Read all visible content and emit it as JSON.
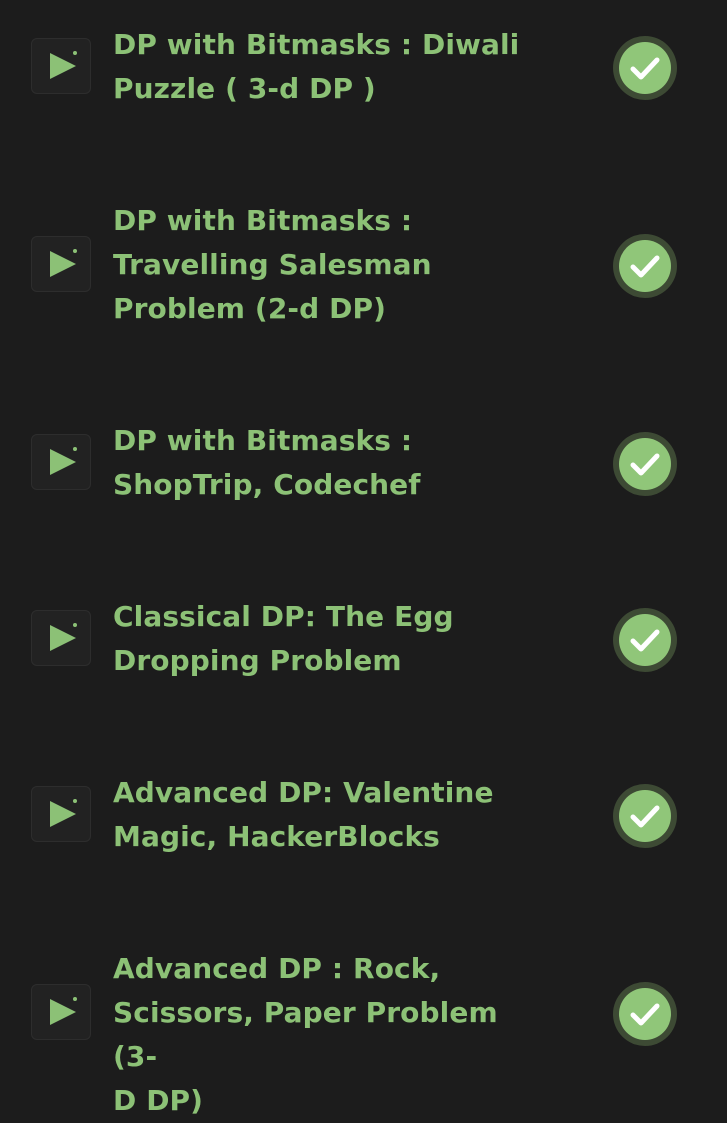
{
  "colors": {
    "background": "#1c1c1c",
    "accent_green": "#8cc176",
    "check_circle": "#90c679",
    "check_ring": "#3d4a34"
  },
  "lessons": [
    {
      "title": "DP with Bitmasks : Diwali\nPuzzle ( 3-d DP )",
      "type_icon": "video-play-icon",
      "status": "completed",
      "status_icon": "check-circle-icon"
    },
    {
      "title": "DP with Bitmasks :\nTravelling Salesman\nProblem (2-d DP)",
      "type_icon": "video-play-icon",
      "status": "completed",
      "status_icon": "check-circle-icon"
    },
    {
      "title": "DP with Bitmasks :\nShopTrip, Codechef",
      "type_icon": "video-play-icon",
      "status": "completed",
      "status_icon": "check-circle-icon"
    },
    {
      "title": "Classical DP: The Egg\nDropping Problem",
      "type_icon": "video-play-icon",
      "status": "completed",
      "status_icon": "check-circle-icon"
    },
    {
      "title": "Advanced DP: Valentine\nMagic, HackerBlocks",
      "type_icon": "video-play-icon",
      "status": "completed",
      "status_icon": "check-circle-icon"
    },
    {
      "title": "Advanced DP : Rock,\nScissors, Paper Problem (3-\nD DP)",
      "type_icon": "video-play-icon",
      "status": "completed",
      "status_icon": "check-circle-icon"
    }
  ]
}
